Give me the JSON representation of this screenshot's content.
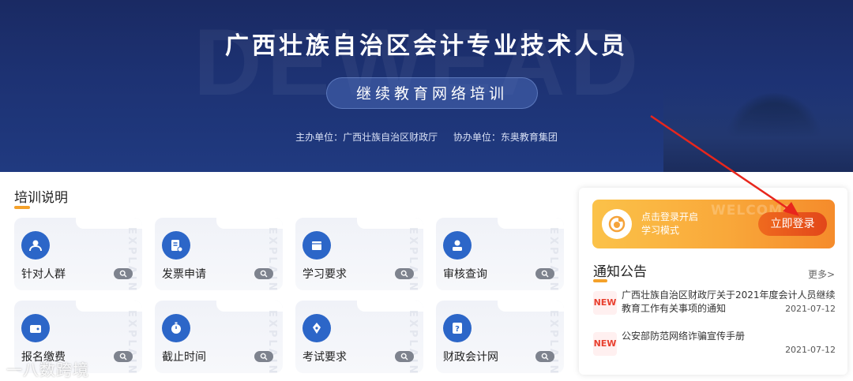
{
  "banner": {
    "title": "广西壮族自治区会计专业技术人员",
    "subtitle": "继续教育网络培训",
    "host_org": "主办单位：广西壮族自治区财政厅",
    "co_org": "协办单位：东奥教育集团"
  },
  "training": {
    "title": "培训说明",
    "watermark_text": "EXPLAIN",
    "cards": [
      {
        "label": "针对人群",
        "icon": "people-icon"
      },
      {
        "label": "发票申请",
        "icon": "invoice-icon"
      },
      {
        "label": "学习要求",
        "icon": "book-icon"
      },
      {
        "label": "审核查询",
        "icon": "user-check-icon"
      },
      {
        "label": "报名缴费",
        "icon": "wallet-icon"
      },
      {
        "label": "截止时间",
        "icon": "stopwatch-icon"
      },
      {
        "label": "考试要求",
        "icon": "pen-icon"
      },
      {
        "label": "财政会计网",
        "icon": "question-icon"
      }
    ]
  },
  "login": {
    "welcome": "WELCOME",
    "hint_line1": "点击登录开启",
    "hint_line2": "学习模式",
    "button": "立即登录"
  },
  "notices": {
    "title": "通知公告",
    "more": "更多>",
    "items": [
      {
        "badge": "NEW",
        "text": "广西壮族自治区财政厅关于2021年度会计人员继续教育工作有关事项的通知",
        "date": "2021-07-12"
      },
      {
        "badge": "NEW",
        "text": "公安部防范网络诈骗宣传手册",
        "date": "2021-07-12"
      }
    ]
  },
  "watermark": "一八数跨境",
  "colors": {
    "banner": "#1d3273",
    "accent_orange": "#f9a83a",
    "button_red": "#e2461a",
    "icon_blue": "#2c66c8",
    "underline": "#f4a12a",
    "new_badge": "#e8402f"
  }
}
